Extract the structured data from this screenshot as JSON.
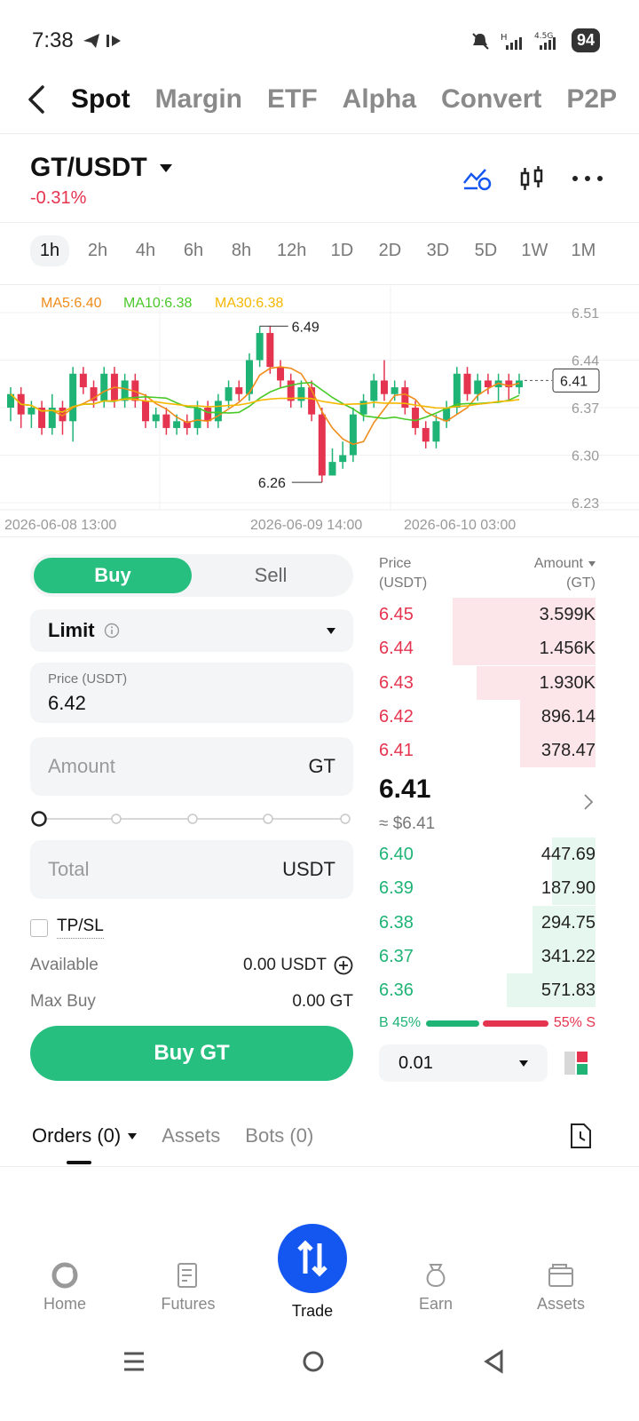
{
  "status": {
    "time": "7:38",
    "network": "4.5G",
    "battery": "94"
  },
  "tabs": [
    "Spot",
    "Margin",
    "ETF",
    "Alpha",
    "Convert",
    "P2P"
  ],
  "pair": {
    "name": "GT/USDT",
    "change": "-0.31%"
  },
  "timeframes": [
    "1h",
    "2h",
    "4h",
    "6h",
    "8h",
    "12h",
    "1D",
    "2D",
    "3D",
    "5D",
    "1W",
    "1M"
  ],
  "chart_data": {
    "type": "candlestick",
    "ma_labels": {
      "ma5": "MA5:6.40",
      "ma10": "MA10:6.38",
      "ma30": "MA30:6.38"
    },
    "y_ticks": [
      "6.51",
      "6.44",
      "6.37",
      "6.30",
      "6.23"
    ],
    "ylim": [
      6.23,
      6.51
    ],
    "x_ticks": [
      "2026-06-08 13:00",
      "2026-06-09 14:00",
      "2026-06-10 03:00"
    ],
    "high_label": "6.49",
    "low_label": "6.26",
    "current_label": "6.41",
    "candles": [
      [
        6.37,
        6.39,
        6.4,
        6.35
      ],
      [
        6.39,
        6.36,
        6.4,
        6.34
      ],
      [
        6.36,
        6.37,
        6.38,
        6.34
      ],
      [
        6.37,
        6.34,
        6.38,
        6.33
      ],
      [
        6.34,
        6.37,
        6.39,
        6.33
      ],
      [
        6.37,
        6.35,
        6.38,
        6.33
      ],
      [
        6.35,
        6.42,
        6.43,
        6.32
      ],
      [
        6.42,
        6.4,
        6.43,
        6.39
      ],
      [
        6.4,
        6.38,
        6.41,
        6.37
      ],
      [
        6.38,
        6.42,
        6.43,
        6.37
      ],
      [
        6.42,
        6.38,
        6.43,
        6.37
      ],
      [
        6.38,
        6.41,
        6.42,
        6.37
      ],
      [
        6.41,
        6.38,
        6.42,
        6.37
      ],
      [
        6.38,
        6.35,
        6.39,
        6.34
      ],
      [
        6.35,
        6.36,
        6.37,
        6.34
      ],
      [
        6.36,
        6.34,
        6.37,
        6.33
      ],
      [
        6.34,
        6.35,
        6.36,
        6.33
      ],
      [
        6.35,
        6.34,
        6.36,
        6.33
      ],
      [
        6.34,
        6.37,
        6.38,
        6.33
      ],
      [
        6.37,
        6.35,
        6.38,
        6.34
      ],
      [
        6.35,
        6.38,
        6.39,
        6.34
      ],
      [
        6.38,
        6.4,
        6.41,
        6.37
      ],
      [
        6.4,
        6.39,
        6.41,
        6.38
      ],
      [
        6.39,
        6.44,
        6.45,
        6.38
      ],
      [
        6.44,
        6.48,
        6.49,
        6.43
      ],
      [
        6.48,
        6.43,
        6.49,
        6.42
      ],
      [
        6.43,
        6.41,
        6.44,
        6.4
      ],
      [
        6.41,
        6.38,
        6.42,
        6.37
      ],
      [
        6.38,
        6.4,
        6.41,
        6.37
      ],
      [
        6.4,
        6.36,
        6.41,
        6.35
      ],
      [
        6.36,
        6.27,
        6.37,
        6.26
      ],
      [
        6.27,
        6.29,
        6.31,
        6.27
      ],
      [
        6.29,
        6.3,
        6.32,
        6.28
      ],
      [
        6.3,
        6.36,
        6.37,
        6.29
      ],
      [
        6.36,
        6.38,
        6.39,
        6.35
      ],
      [
        6.38,
        6.41,
        6.42,
        6.37
      ],
      [
        6.41,
        6.39,
        6.44,
        6.38
      ],
      [
        6.39,
        6.4,
        6.41,
        6.38
      ],
      [
        6.4,
        6.37,
        6.41,
        6.36
      ],
      [
        6.37,
        6.34,
        6.38,
        6.33
      ],
      [
        6.34,
        6.32,
        6.35,
        6.31
      ],
      [
        6.32,
        6.35,
        6.36,
        6.31
      ],
      [
        6.35,
        6.37,
        6.38,
        6.34
      ],
      [
        6.37,
        6.42,
        6.43,
        6.36
      ],
      [
        6.42,
        6.39,
        6.43,
        6.38
      ],
      [
        6.39,
        6.41,
        6.42,
        6.38
      ],
      [
        6.41,
        6.4,
        6.42,
        6.39
      ],
      [
        6.4,
        6.41,
        6.42,
        6.38
      ],
      [
        6.41,
        6.4,
        6.42,
        6.38
      ],
      [
        6.4,
        6.41,
        6.42,
        6.39
      ]
    ],
    "colors": {
      "up": "#1fb376",
      "down": "#e5344f",
      "ma5": "#f08c1a",
      "ma10": "#49c928",
      "ma30": "#f5b800"
    }
  },
  "order_form": {
    "buy_label": "Buy",
    "sell_label": "Sell",
    "order_type": "Limit",
    "price_label": "Price (USDT)",
    "price_value": "6.42",
    "amount_placeholder": "Amount",
    "amount_unit": "GT",
    "total_placeholder": "Total",
    "total_unit": "USDT",
    "tpsl_label": "TP/SL",
    "available_label": "Available",
    "available_value": "0.00 USDT",
    "max_buy_label": "Max Buy",
    "max_buy_value": "0.00 GT",
    "submit_label": "Buy GT",
    "slider_percent": 0
  },
  "order_book": {
    "price_header": "Price",
    "price_unit": "(USDT)",
    "amount_header": "Amount",
    "amount_unit": "(GT)",
    "asks": [
      {
        "price": "6.45",
        "amount": "3.599K",
        "depth": 0.66
      },
      {
        "price": "6.44",
        "amount": "1.456K",
        "depth": 0.66
      },
      {
        "price": "6.43",
        "amount": "1.930K",
        "depth": 0.55
      },
      {
        "price": "6.42",
        "amount": "896.14",
        "depth": 0.35
      },
      {
        "price": "6.41",
        "amount": "378.47",
        "depth": 0.35
      }
    ],
    "last_price": "6.41",
    "last_price_usd": "≈ $6.41",
    "bids": [
      {
        "price": "6.40",
        "amount": "447.69",
        "depth": 0.2
      },
      {
        "price": "6.39",
        "amount": "187.90",
        "depth": 0.2
      },
      {
        "price": "6.38",
        "amount": "294.75",
        "depth": 0.29
      },
      {
        "price": "6.37",
        "amount": "341.22",
        "depth": 0.29
      },
      {
        "price": "6.36",
        "amount": "571.83",
        "depth": 0.41
      }
    ],
    "buy_ratio": "B 45%",
    "sell_ratio": "55% S",
    "buy_ratio_value": 45,
    "depth_value": "0.01"
  },
  "orders_tabs": {
    "orders": "Orders (0)",
    "assets": "Assets",
    "bots": "Bots (0)"
  },
  "nav": {
    "home": "Home",
    "futures": "Futures",
    "trade": "Trade",
    "earn": "Earn",
    "assets": "Assets"
  }
}
